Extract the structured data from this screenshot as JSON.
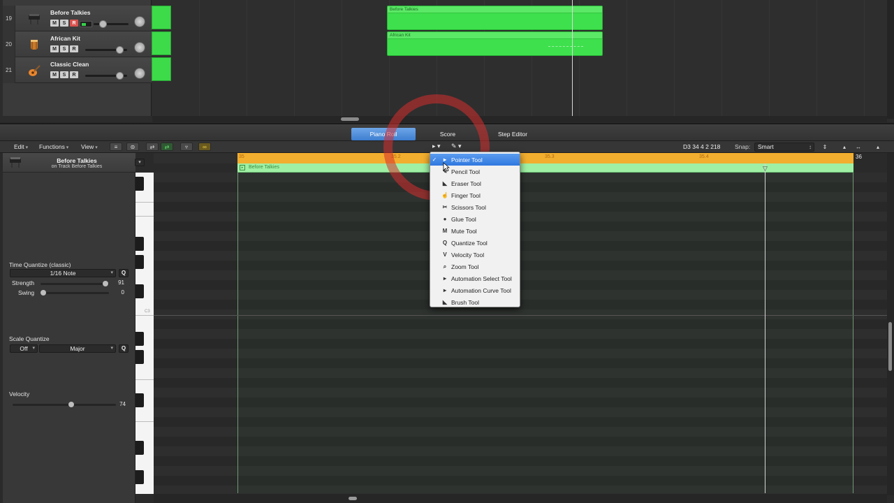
{
  "tracks": [
    {
      "number": "19",
      "name": "Before Talkies",
      "icon": "piano-icon",
      "m": "M",
      "s": "S",
      "r": "R"
    },
    {
      "number": "20",
      "name": "African Kit",
      "icon": "drum-icon",
      "m": "M",
      "s": "S",
      "r": "R"
    },
    {
      "number": "21",
      "name": "Classic Clean",
      "icon": "guitar-icon",
      "m": "M",
      "s": "S",
      "r": "R"
    }
  ],
  "arrange_regions": [
    {
      "name": "Before Talkies"
    },
    {
      "name": "African Kit"
    }
  ],
  "editor_tabs": {
    "piano_roll": "Piano Roll",
    "score": "Score",
    "step_editor": "Step Editor",
    "active": "Piano Roll"
  },
  "toolbar": {
    "edit": "Edit",
    "functions": "Functions",
    "view": "View",
    "position": "D3   34 4 2 218",
    "snap_label": "Snap:",
    "snap_value": "Smart"
  },
  "inspector": {
    "region_name": "Before Talkies",
    "region_subtitle": "on Track Before Talkies",
    "time_quantize_label": "Time Quantize (classic)",
    "time_quantize_value": "1/16 Note",
    "q": "Q",
    "strength_label": "Strength",
    "strength_value": "91",
    "swing_label": "Swing",
    "swing_value": "0",
    "scale_quantize_label": "Scale Quantize",
    "scale_off": "Off",
    "scale_mode": "Major",
    "velocity_label": "Velocity",
    "velocity_value": "74"
  },
  "keyboard": {
    "c3_label": "C3"
  },
  "ruler": {
    "marks": [
      "35",
      "35.2",
      "35.3",
      "35.4"
    ],
    "end_mark": "36"
  },
  "roll_region_name": "Before Talkies",
  "tool_menu": {
    "items": [
      {
        "label": "Pointer Tool",
        "icon": "pointer-icon",
        "glyph": "▸",
        "checked": true
      },
      {
        "label": "Pencil Tool",
        "icon": "pencil-icon",
        "glyph": "✎",
        "checked": false
      },
      {
        "label": "Eraser Tool",
        "icon": "eraser-icon",
        "glyph": "◣",
        "checked": false
      },
      {
        "label": "Finger Tool",
        "icon": "finger-icon",
        "glyph": "☝",
        "checked": false
      },
      {
        "label": "Scissors Tool",
        "icon": "scissors-icon",
        "glyph": "✂",
        "checked": false
      },
      {
        "label": "Glue Tool",
        "icon": "glue-icon",
        "glyph": "●",
        "checked": false
      },
      {
        "label": "Mute Tool",
        "icon": "mute-icon",
        "glyph": "M",
        "checked": false
      },
      {
        "label": "Quantize Tool",
        "icon": "quantize-icon",
        "glyph": "Q",
        "checked": false
      },
      {
        "label": "Velocity Tool",
        "icon": "velocity-icon",
        "glyph": "V",
        "checked": false
      },
      {
        "label": "Zoom Tool",
        "icon": "zoom-icon",
        "glyph": "⌕",
        "checked": false
      },
      {
        "label": "Automation Select Tool",
        "icon": "automation-select-icon",
        "glyph": "▸",
        "checked": false
      },
      {
        "label": "Automation Curve Tool",
        "icon": "automation-curve-icon",
        "glyph": "▸",
        "checked": false
      },
      {
        "label": "Brush Tool",
        "icon": "brush-icon",
        "glyph": "◣",
        "checked": false
      }
    ]
  },
  "colors": {
    "region_green": "#3ee04d",
    "ruler_orange": "#f2ae2e",
    "active_blue": "#2f78df",
    "highlight_red": "#d72d2d"
  }
}
